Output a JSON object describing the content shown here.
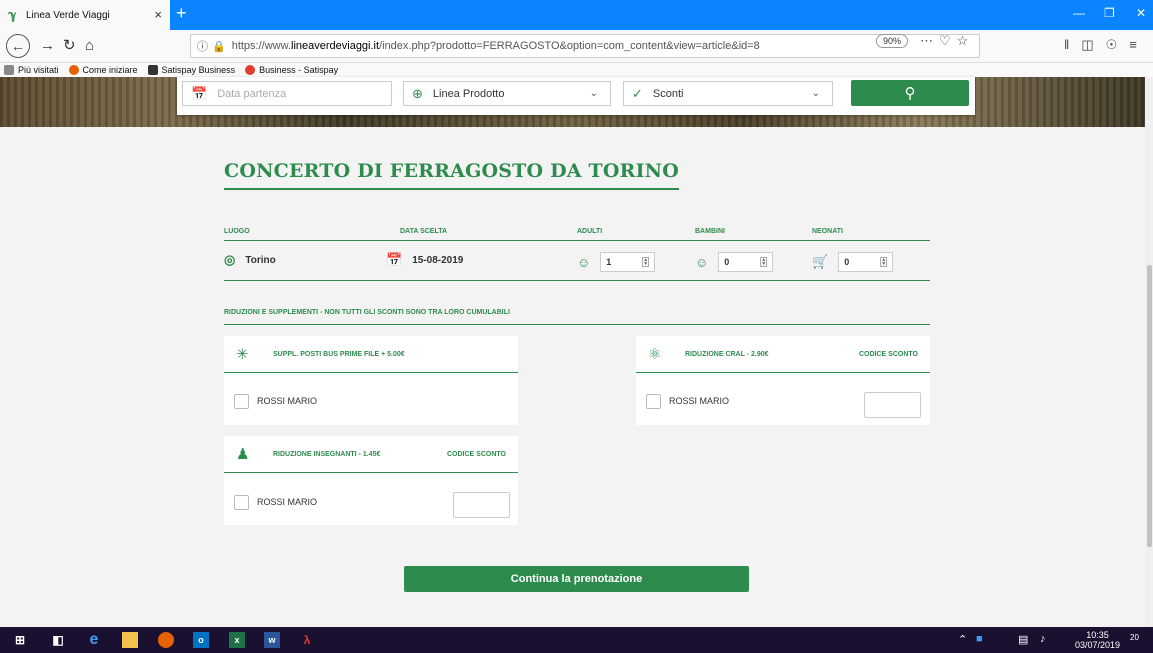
{
  "browser": {
    "tab_title": "Linea Verde Viaggi",
    "tab_close": "×",
    "new_tab": "+",
    "url_prefix": "https://www.",
    "url_domain": "lineaverdeviaggi.it",
    "url_rest": "/index.php?prodotto=FERRAGOSTO&option=com_content&view=article&id=8",
    "zoom": "90%",
    "bookmarks": [
      {
        "label": "Più visitati",
        "icon": "gear-icon",
        "color": "#555555"
      },
      {
        "label": "Come iniziare",
        "icon": "firefox-icon",
        "color": "#e66000"
      },
      {
        "label": "Satispay Business",
        "icon": "satispay-icon",
        "color": "#333333"
      },
      {
        "label": "Business - Satispay",
        "icon": "satispay-icon",
        "color": "#e03c31"
      }
    ]
  },
  "search": {
    "date_placeholder": "Data partenza",
    "product_label": "Linea Prodotto",
    "discount_label": "Sconti"
  },
  "main": {
    "title": "CONCERTO DI FERRAGOSTO DA TORINO",
    "columns": {
      "luogo": "LUOGO",
      "data": "DATA SCELTA",
      "adulti": "ADULTI",
      "bambini": "BAMBINI",
      "neonati": "NEONATI"
    },
    "values": {
      "luogo": "Torino",
      "data": "15-08-2019",
      "adulti": "1",
      "bambini": "0",
      "neonati": "0"
    },
    "reductions_title": "RIDUZIONI E SUPPLEMENTI - NON TUTTI GLI SCONTI SONO TRA LORO CUMULABILI",
    "cards": {
      "bus": {
        "label": "SUPPL. POSTI BUS PRIME FILE + 5.00€",
        "person": "ROSSI MARIO"
      },
      "cral": {
        "label": "RIDUZIONE CRAL - 2.90€",
        "code": "CODICE SCONTO",
        "person": "ROSSI MARIO"
      },
      "insegnanti": {
        "label": "RIDUZIONE INSEGNANTI - 1.45€",
        "code": "CODICE SCONTO",
        "person": "ROSSI MARIO"
      }
    },
    "cta": "Continua la prenotazione"
  },
  "taskbar": {
    "time": "10:35",
    "date": "03/07/2019",
    "notif": "20"
  },
  "colors": {
    "brand_green": "#2e8b4e",
    "firefox_blue": "#0a84ff"
  }
}
